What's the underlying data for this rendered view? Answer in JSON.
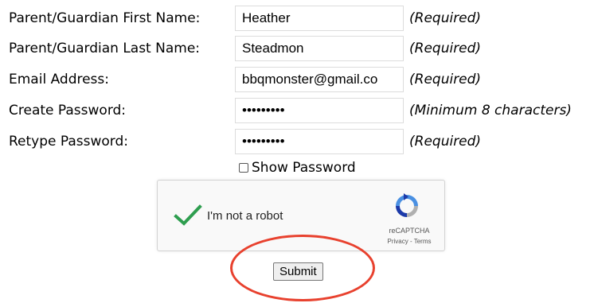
{
  "form": {
    "fields": [
      {
        "label": "Parent/Guardian First Name:",
        "value": "Heather",
        "note": "(Required)"
      },
      {
        "label": "Parent/Guardian Last Name:",
        "value": "Steadmon",
        "note": "(Required)"
      },
      {
        "label": "Email Address:",
        "value": "bbqmonster@gmail.co",
        "note": "(Required)"
      },
      {
        "label": "Create Password:",
        "value": "•••••••••",
        "note": "(Minimum 8 characters)"
      },
      {
        "label": "Retype Password:",
        "value": "•••••••••",
        "note": "(Required)"
      }
    ],
    "show_password_label": "Show Password",
    "submit_label": "Submit"
  },
  "captcha": {
    "label": "I'm not a robot",
    "brand": "reCAPTCHA",
    "links": "Privacy - Terms"
  },
  "colors": {
    "annotation_circle": "#e8412e",
    "checkmark": "#2e9e4f"
  }
}
